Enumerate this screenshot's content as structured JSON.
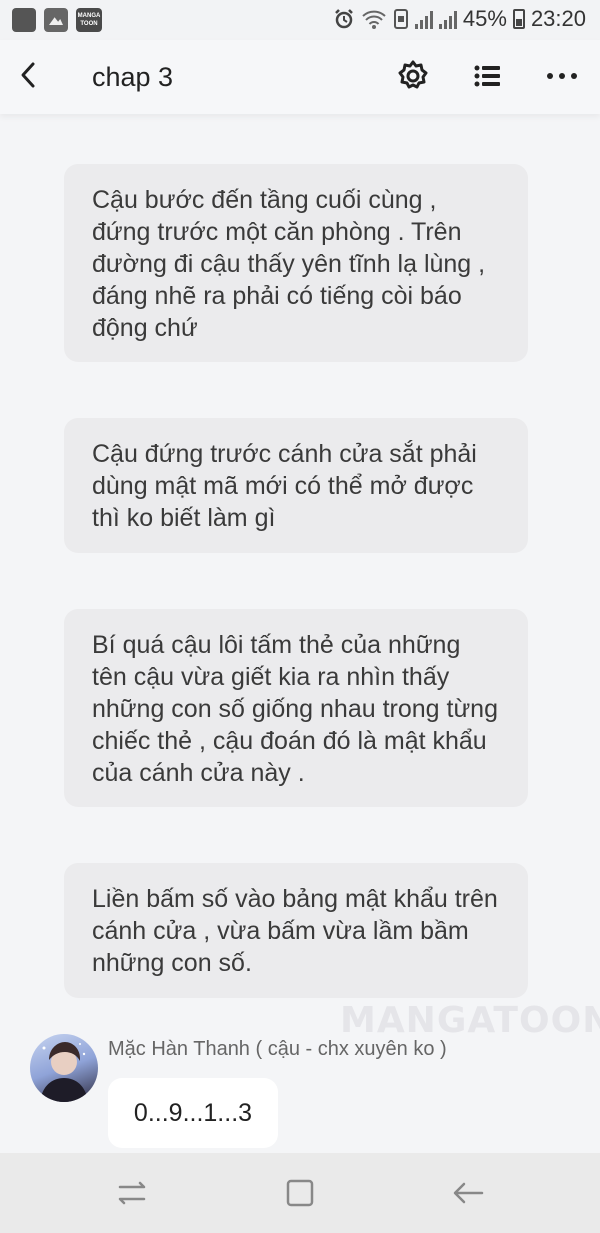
{
  "status_bar": {
    "logo_text": "MANGA TOON",
    "battery": "45%",
    "time": "23:20"
  },
  "header": {
    "title": "chap 3",
    "icons": {
      "back": "back-arrow-icon",
      "settings": "gear-icon",
      "list": "list-icon",
      "more": "more-dots-icon"
    }
  },
  "story": {
    "narrations": [
      "Cậu bước đến tầng cuối cùng , đứng trước một căn phòng . Trên đường đi cậu thấy yên tĩnh lạ lùng , đáng nhẽ ra phải có tiếng còi báo động chứ",
      "Cậu đứng trước cánh cửa sắt phải dùng mật mã mới có thể mở được thì ko biết làm gì",
      "Bí quá cậu lôi tấm thẻ của những tên cậu vừa giết kia ra nhìn thấy những con số giống nhau trong từng chiếc thẻ , cậu đoán đó là mật khẩu của cánh cửa này .",
      "Liền bấm số vào bảng mật khẩu trên cánh cửa , vừa bấm vừa lầm bầm những con số."
    ],
    "watermark": "MANGATOON",
    "dialogue": {
      "character_name": "Mặc Hàn Thanh ( cậu - chx xuyên ko )",
      "text": "0...9...1...3"
    }
  },
  "nav_bar": {
    "icons": [
      "recent-apps-icon",
      "home-icon",
      "back-icon"
    ]
  },
  "colors": {
    "background": "#f4f5f7",
    "bubble": "#ebebed",
    "dialogue_bubble": "#ffffff",
    "text": "#3a3a3a"
  }
}
